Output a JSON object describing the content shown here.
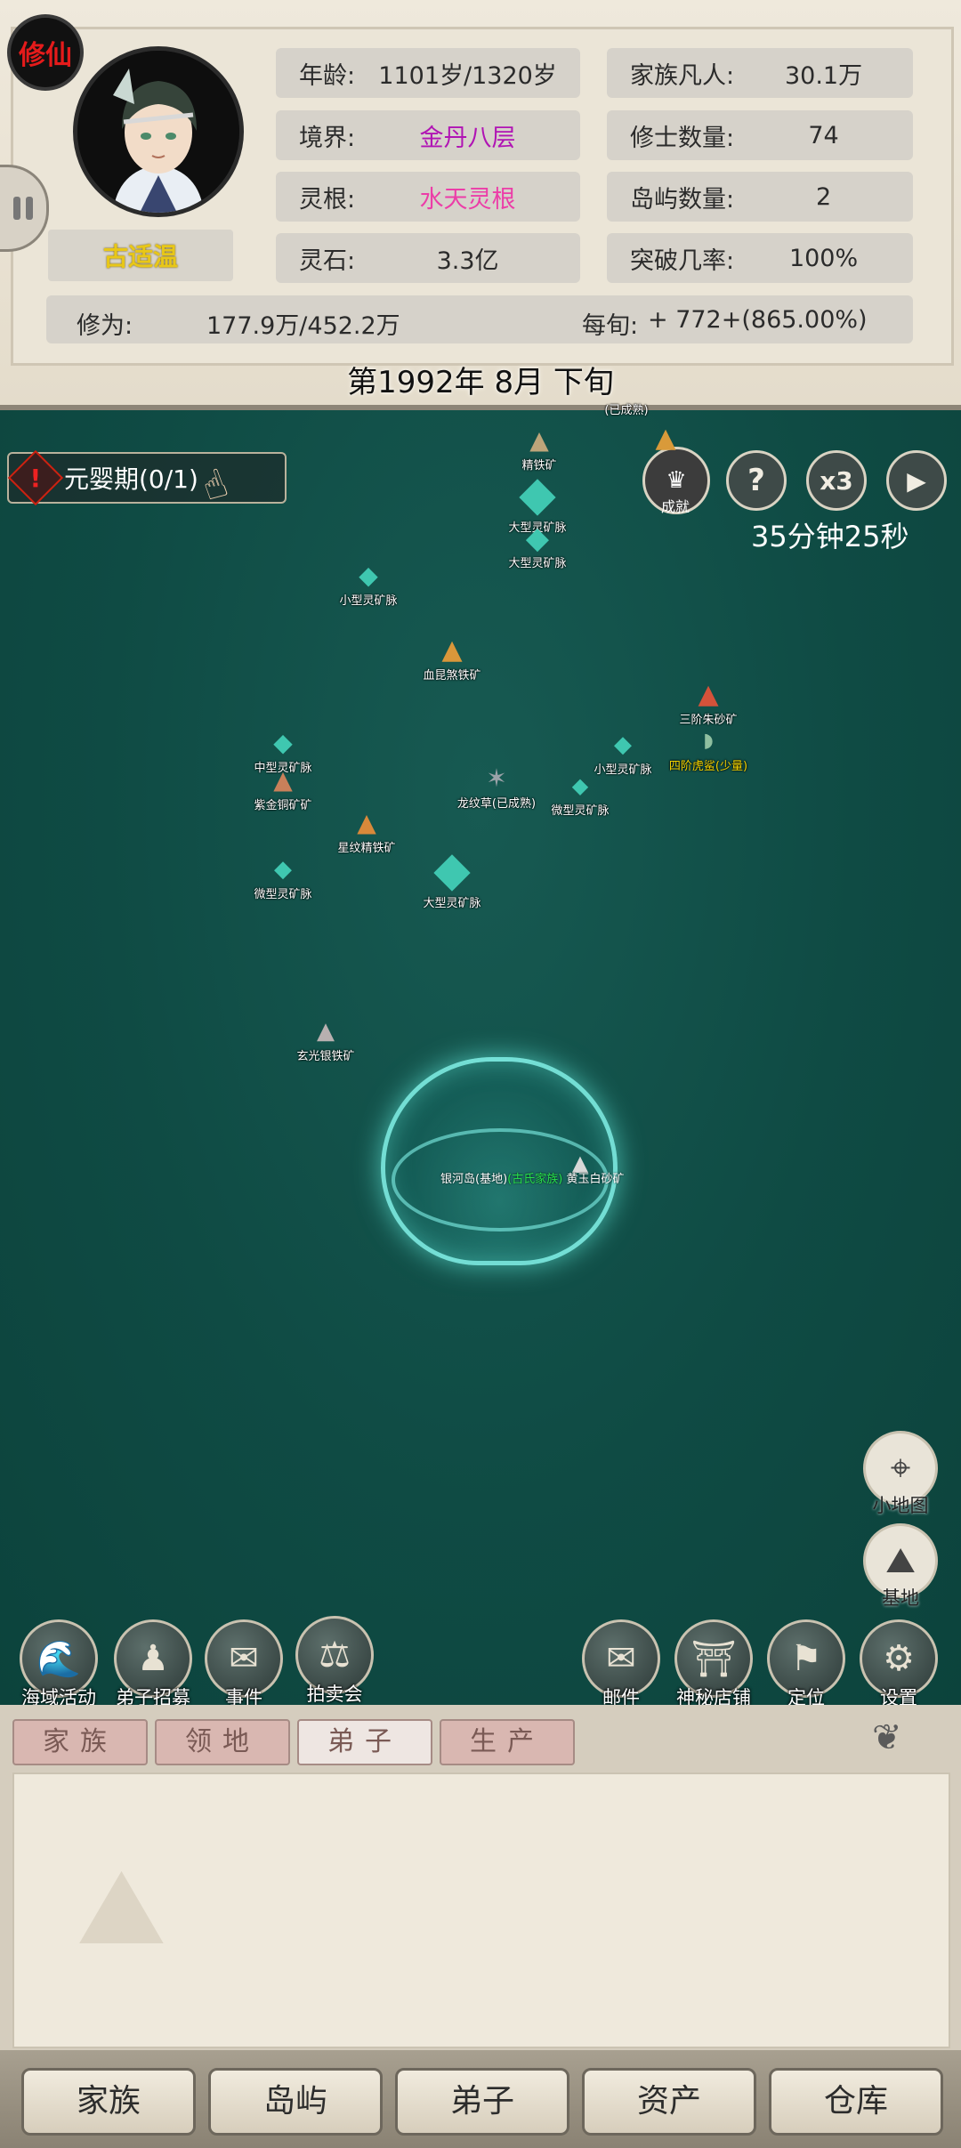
{
  "header": {
    "badge": "修仙",
    "player_name": "古适温",
    "stats": {
      "age_label": "年龄:",
      "age_value": "1101岁/1320岁",
      "realm_label": "境界:",
      "realm_value": "金丹八层",
      "root_label": "灵根:",
      "root_value": "水天灵根",
      "stone_label": "灵石:",
      "stone_value": "3.3亿",
      "mortals_label": "家族凡人:",
      "mortals_value": "30.1万",
      "cultivators_label": "修士数量:",
      "cultivators_value": "74",
      "islands_label": "岛屿数量:",
      "islands_value": "2",
      "breakthrough_label": "突破几率:",
      "breakthrough_value": "100%"
    },
    "cultivation_label": "修为:",
    "cultivation_value": "177.9万/452.2万",
    "per_period_label": "每旬:",
    "per_period_value": "+ 772+(865.00%)",
    "date": "第1992年 8月 下旬"
  },
  "quest": {
    "text": "元婴期(0/1)"
  },
  "controls": {
    "achievement_label": "成就",
    "help": "?",
    "speed": "x3",
    "timer": "35分钟25秒"
  },
  "map_nodes": [
    {
      "label": "(已成熟)"
    },
    {
      "label": "精铁矿"
    },
    {
      "label": "大型灵矿脉"
    },
    {
      "label": "大型灵矿脉"
    },
    {
      "label": "小型灵矿脉"
    },
    {
      "label": "血昆煞铁矿"
    },
    {
      "label": "三阶朱砂矿"
    },
    {
      "label": "四阶虎鲨(少量)"
    },
    {
      "label": "中型灵矿脉"
    },
    {
      "label": "紫金铜矿矿"
    },
    {
      "label": "龙纹草(已成熟)"
    },
    {
      "label": "小型灵矿脉"
    },
    {
      "label": "微型灵矿脉"
    },
    {
      "label": "星纹精铁矿"
    },
    {
      "label": "微型灵矿脉"
    },
    {
      "label": "大型灵矿脉"
    },
    {
      "label": "玄光银铁矿"
    },
    {
      "label": "黄玉白砂矿"
    }
  ],
  "home": {
    "name": "银河岛(基地)",
    "family": "(古氏家族)"
  },
  "right_tools": {
    "minimap": "小地图",
    "base": "基地"
  },
  "actions_left": [
    "海域活动",
    "弟子招募",
    "事件",
    "拍卖会"
  ],
  "actions_right": [
    "邮件",
    "神秘店铺",
    "定位",
    "设置"
  ],
  "tabs": [
    "家族",
    "领地",
    "弟子",
    "生产"
  ],
  "active_tab": "弟子",
  "bottom_nav": [
    "家族",
    "岛屿",
    "弟子",
    "资产",
    "仓库"
  ]
}
